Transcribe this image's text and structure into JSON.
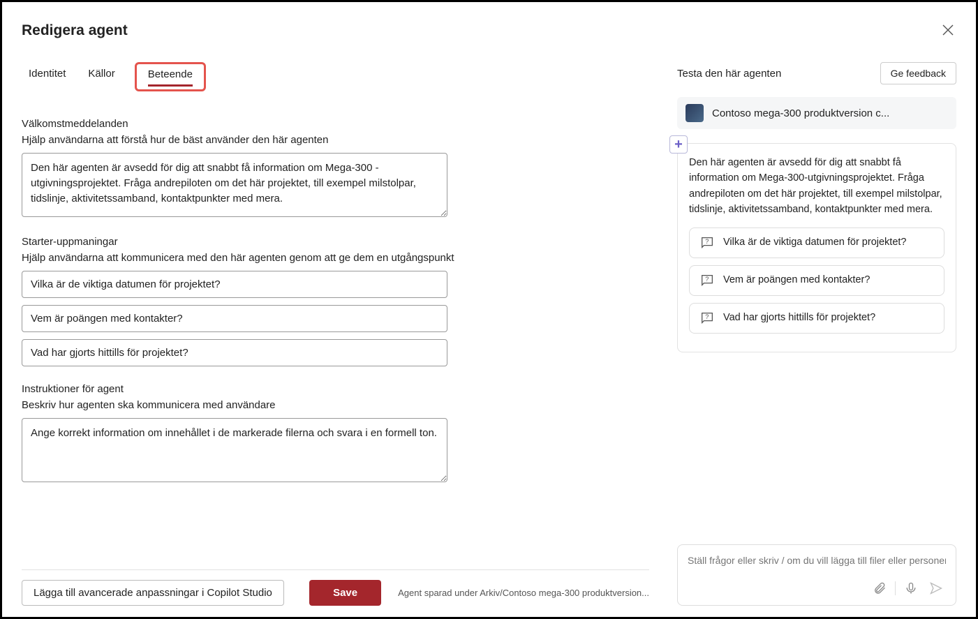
{
  "title": "Redigera agent",
  "tabs": {
    "identity": "Identitet",
    "sources": "Källor",
    "behavior": "Beteende"
  },
  "welcome": {
    "heading": "Välkomstmeddelanden",
    "desc": "Hjälp användarna att förstå hur de bäst använder den här agenten",
    "value": "Den här agenten är avsedd för dig att snabbt få information om Mega-300 -utgivningsprojektet. Fråga andrepiloten om det här projektet, till exempel milstolpar, tidslinje, aktivitetssamband, kontaktpunkter med mera."
  },
  "starters": {
    "heading": "Starter-uppmaningar",
    "desc": "Hjälp användarna att kommunicera med den här agenten genom att ge dem en utgångspunkt",
    "items": [
      "Vilka är de viktiga datumen för projektet?",
      "Vem är poängen med kontakter?",
      "Vad har gjorts hittills för projektet?"
    ]
  },
  "instructions": {
    "heading": "Instruktioner för agent",
    "desc": "Beskriv hur agenten ska kommunicera med användare",
    "value": "Ange korrekt information om innehållet i de markerade filerna och svara i en formell ton."
  },
  "footer": {
    "advanced": "Lägga till avancerade anpassningar i Copilot Studio",
    "save": "Save",
    "status": "Agent sparad under Arkiv/Contoso mega-300 produktversion..."
  },
  "preview": {
    "heading": "Testa den här agenten",
    "feedback": "Ge feedback",
    "agent_name": "Contoso mega-300 produktversion c...",
    "welcome_text": "Den här agenten är avsedd för dig att snabbt få information om Mega-300-utgivningsprojektet. Fråga andrepiloten om det här projektet, till exempel milstolpar, tidslinje, aktivitetssamband, kontaktpunkter med mera.",
    "starters": [
      "Vilka är de viktiga datumen för projektet?",
      "Vem är poängen med kontakter?",
      "Vad har gjorts hittills för projektet?"
    ],
    "input_placeholder": "Ställ frågor eller skriv / om du vill lägga till filer eller personer."
  }
}
